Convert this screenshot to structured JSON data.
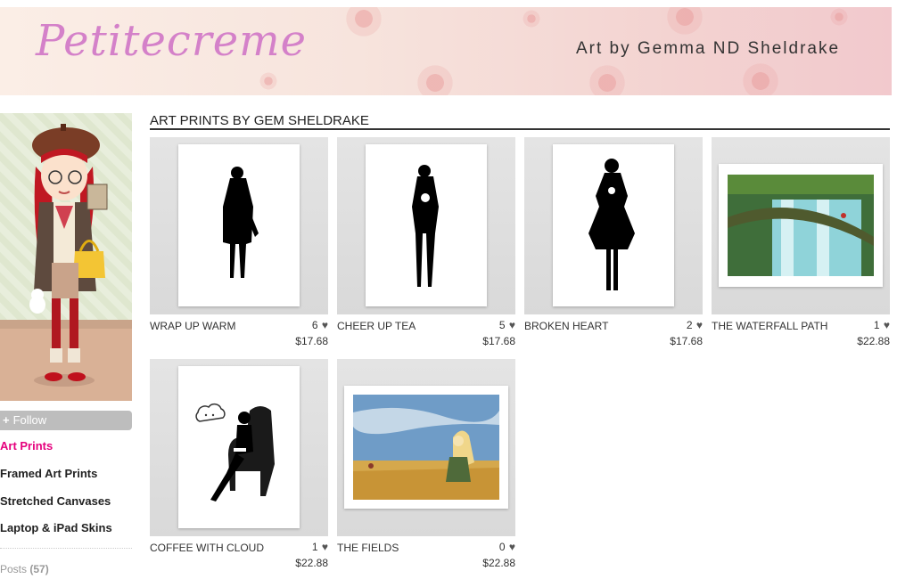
{
  "header": {
    "logo": "Petitecreme",
    "tagline": "Art by Gemma ND Sheldrake"
  },
  "sidebar": {
    "follow_label": "Follow",
    "links": [
      {
        "label": "Art Prints",
        "active": true
      },
      {
        "label": "Framed Art Prints",
        "active": false
      },
      {
        "label": "Stretched Canvases",
        "active": false
      },
      {
        "label": "Laptop & iPad Skins",
        "active": false
      }
    ],
    "posts_label": "Posts",
    "posts_count": "(57)"
  },
  "main": {
    "title": "ART PRINTS BY GEM SHELDRAKE",
    "products": [
      {
        "title": "WRAP UP WARM",
        "likes": "6",
        "price": "$17.68",
        "art": "silhouette-coat"
      },
      {
        "title": "CHEER UP TEA",
        "likes": "5",
        "price": "$17.68",
        "art": "silhouette-tea"
      },
      {
        "title": "BROKEN HEART",
        "likes": "2",
        "price": "$17.68",
        "art": "silhouette-dress"
      },
      {
        "title": "THE WATERFALL PATH",
        "likes": "1",
        "price": "$22.88",
        "art": "waterfall-landscape"
      },
      {
        "title": "COFFEE WITH CLOUD",
        "likes": "1",
        "price": "$22.88",
        "art": "armchair-cloud"
      },
      {
        "title": "THE FIELDS",
        "likes": "0",
        "price": "$22.88",
        "art": "wheat-field"
      }
    ]
  },
  "icons": {
    "like": "heart-icon",
    "follow": "plus-icon"
  },
  "colors": {
    "accent": "#e5007d",
    "logo": "#d481c9",
    "follow_button": "#bdbdbd"
  }
}
